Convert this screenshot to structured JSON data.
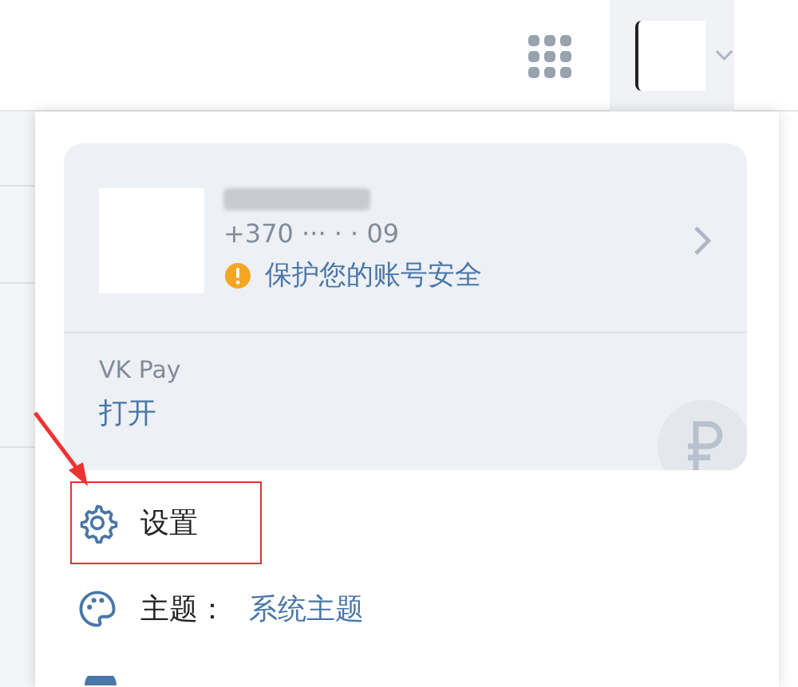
{
  "profile": {
    "phone": "+370 ··· · · 09",
    "security_warning": "保护您的账号安全"
  },
  "vk_pay": {
    "title": "VK Pay",
    "action": "打开"
  },
  "menu": [
    {
      "kind": "settings",
      "label": "设置",
      "highlighted": true
    },
    {
      "kind": "theme",
      "label": "主题：",
      "value": "系统主题",
      "highlighted": false
    }
  ]
}
